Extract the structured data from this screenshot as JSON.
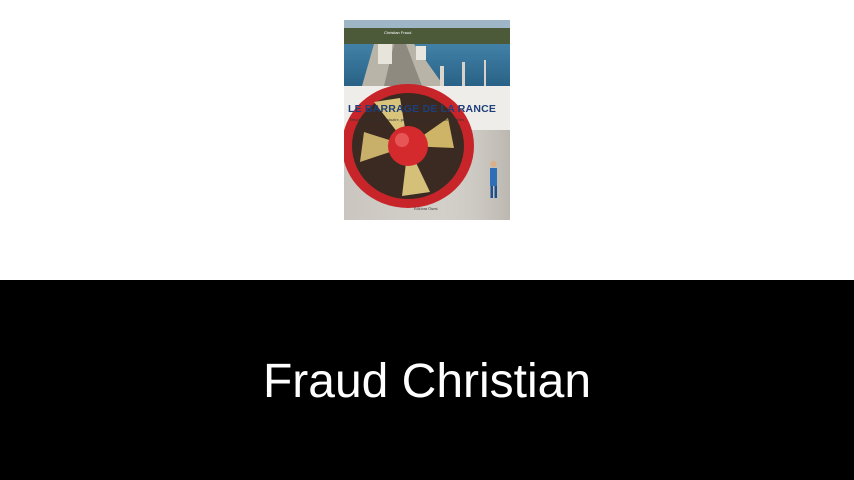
{
  "book": {
    "cover_author": "Christian Fraud",
    "cover_title": "LE BARRAGE DE LA RANCE",
    "cover_subtitle": "Témoin des marées à estuaire, précurseur des énergies renouvelables",
    "cover_publisher": "Éditions Ouest"
  },
  "caption": {
    "author_name": "Fraud Christian"
  },
  "colors": {
    "caption_background": "#000000",
    "caption_text": "#ffffff",
    "title_blue": "#1d3f7a",
    "turbine_red": "#d42a2e"
  }
}
